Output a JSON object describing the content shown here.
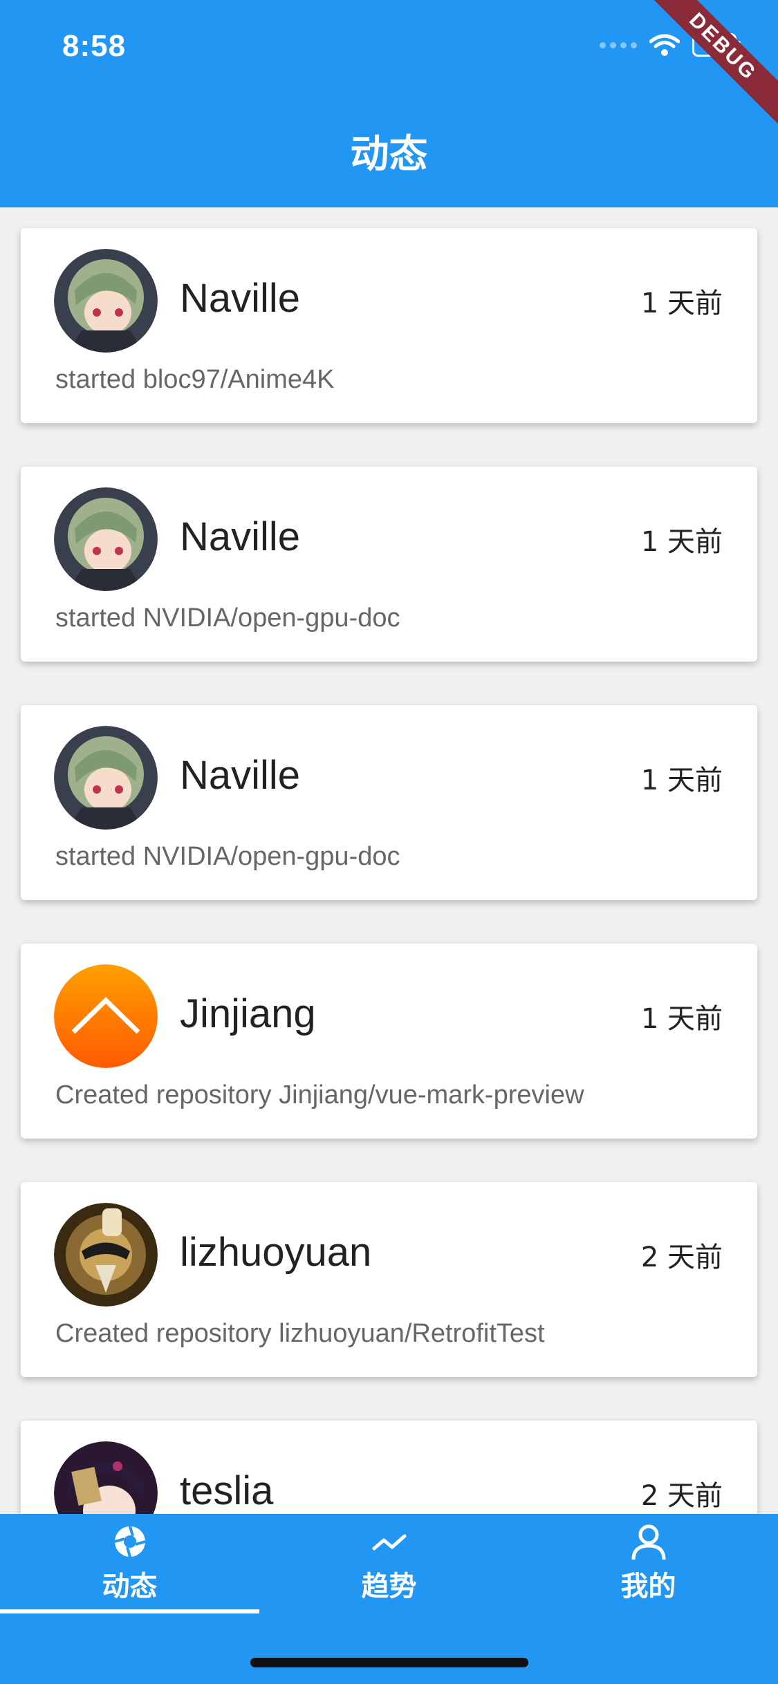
{
  "status_bar": {
    "time": "8:58"
  },
  "debug_banner": "DEBUG",
  "app_bar": {
    "title": "动态"
  },
  "events": [
    {
      "user": "Naville",
      "time": "1 天前",
      "action": "started bloc97/Anime4K",
      "avatar": "anime-avatar"
    },
    {
      "user": "Naville",
      "time": "1 天前",
      "action": "started NVIDIA/open-gpu-doc",
      "avatar": "anime-avatar"
    },
    {
      "user": "Naville",
      "time": "1 天前",
      "action": "started NVIDIA/open-gpu-doc",
      "avatar": "anime-avatar"
    },
    {
      "user": "Jinjiang",
      "time": "1 天前",
      "action": "Created repository Jinjiang/vue-mark-preview",
      "avatar": "orange-logo-avatar"
    },
    {
      "user": "lizhuoyuan",
      "time": "2 天前",
      "action": "Created repository lizhuoyuan/RetrofitTest",
      "avatar": "photo-avatar"
    },
    {
      "user": "teslia",
      "time": "2 天前",
      "action": "",
      "avatar": "anime-avatar-dark"
    }
  ],
  "bottom_nav": {
    "tabs": [
      {
        "label": "动态",
        "icon": "aperture-icon",
        "selected": true
      },
      {
        "label": "趋势",
        "icon": "trend-icon",
        "selected": false
      },
      {
        "label": "我的",
        "icon": "person-icon",
        "selected": false
      }
    ]
  },
  "colors": {
    "primary": "#2196f3",
    "debug": "#8b2b3a"
  }
}
